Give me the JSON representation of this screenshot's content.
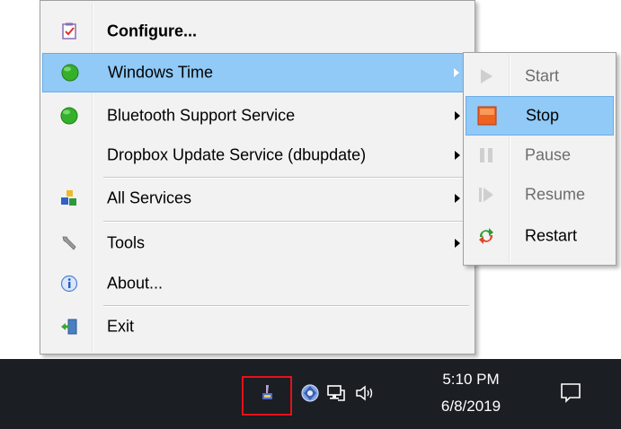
{
  "menu": {
    "items": [
      {
        "label": "Configure...",
        "icon": "checklist-icon",
        "bold": true
      },
      {
        "label": "Windows Time",
        "icon": "green-status-icon",
        "submenu": true,
        "highlighted": true
      },
      {
        "label": "Bluetooth Support Service",
        "icon": "green-status-icon",
        "submenu": true
      },
      {
        "label": "Dropbox Update Service (dbupdate)",
        "icon": "",
        "submenu": true
      },
      {
        "label": "All Services",
        "icon": "services-icon",
        "submenu": true
      },
      {
        "label": "Tools",
        "icon": "wrench-icon",
        "submenu": true
      },
      {
        "label": "About...",
        "icon": "info-icon"
      },
      {
        "label": "Exit",
        "icon": "exit-icon"
      }
    ]
  },
  "submenu": {
    "items": [
      {
        "label": "Start",
        "icon": "play-icon",
        "disabled": true
      },
      {
        "label": "Stop",
        "icon": "stop-icon",
        "highlighted": true
      },
      {
        "label": "Pause",
        "icon": "pause-icon",
        "disabled": true
      },
      {
        "label": "Resume",
        "icon": "play-icon",
        "disabled": true
      },
      {
        "label": "Restart",
        "icon": "restart-icon"
      }
    ]
  },
  "taskbar": {
    "time": "5:10 PM",
    "date": "6/8/2019",
    "tray_icons": [
      "service-tray-icon",
      "globe-icon",
      "network-icon",
      "speaker-icon",
      "notification-icon"
    ]
  },
  "colors": {
    "highlight": "#91c9f7",
    "taskbar": "#1b1e23",
    "tray_box": "#e8101a"
  }
}
